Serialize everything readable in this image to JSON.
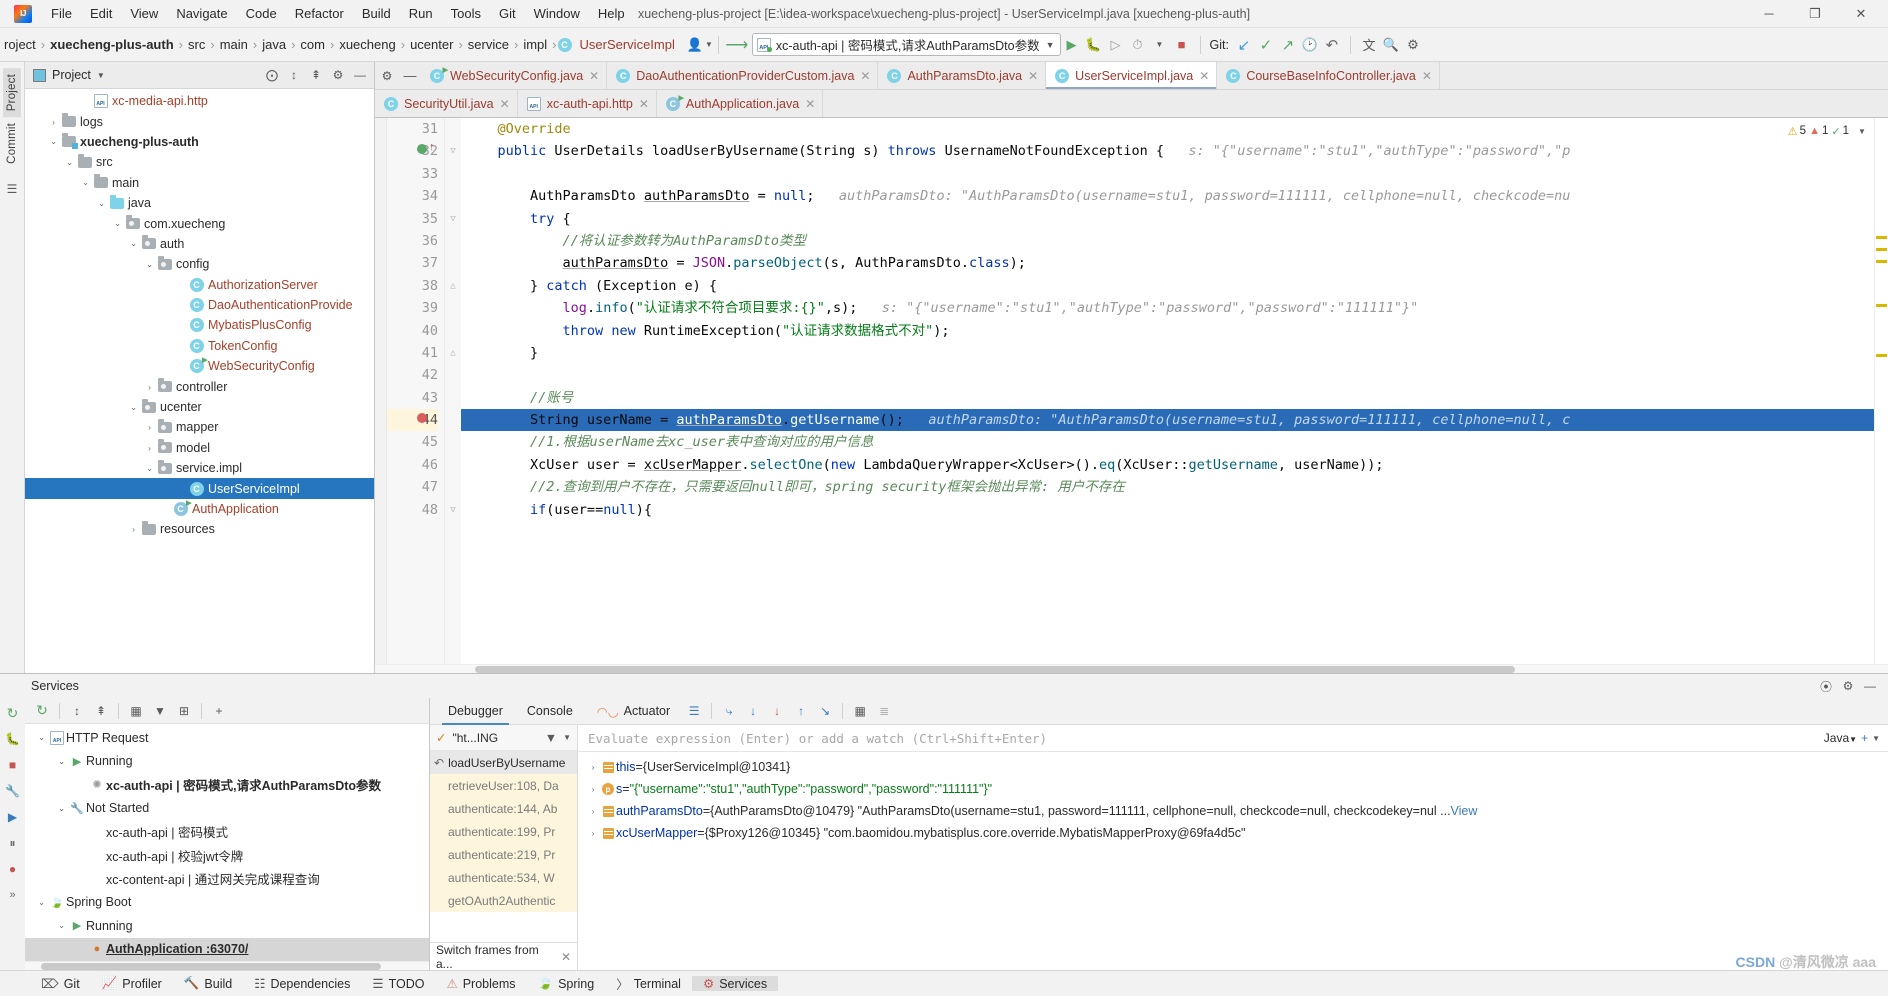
{
  "titlebar": {
    "window_title": "xuecheng-plus-project [E:\\idea-workspace\\xuecheng-plus-project] - UserServiceImpl.java [xuecheng-plus-auth]",
    "menus": [
      "File",
      "Edit",
      "View",
      "Navigate",
      "Code",
      "Refactor",
      "Build",
      "Run",
      "Tools",
      "Git",
      "Window",
      "Help"
    ],
    "controls": {
      "minimize": "─",
      "maximize": "❐",
      "close": "✕"
    }
  },
  "navbar": {
    "crumbs": [
      "roject",
      "xuecheng-plus-auth",
      "src",
      "main",
      "java",
      "com",
      "xuecheng",
      "ucenter",
      "service",
      "impl",
      "UserServiceImpl"
    ],
    "crumb_sep": "›",
    "class_icon_letter": "C",
    "run_config": "xc-auth-api | 密码模式,请求AuthParamsDto参数",
    "api_badge": "API",
    "git_label": "Git:",
    "icons": [
      "profile-icon",
      "hammer-icon",
      "run-icon",
      "debug-icon",
      "coverage-icon",
      "profiler-icon",
      "stop-icon",
      "update-project-icon",
      "commit-icon",
      "push-icon",
      "history-icon",
      "rollback-icon",
      "translate-icon",
      "search-everywhere-icon",
      "settings-icon"
    ]
  },
  "left_strip": {
    "tabs": [
      "Project",
      "Commit"
    ],
    "icons": [
      "structure-icon"
    ]
  },
  "project_panel": {
    "title": "Project",
    "actions": [
      "locate-icon",
      "expand-all-icon",
      "collapse-all-icon",
      "settings-icon",
      "hide-icon"
    ],
    "tree": [
      {
        "indent": 3,
        "twist": "",
        "icon": "api-file",
        "label": "xc-media-api.http",
        "style": "red"
      },
      {
        "indent": 1,
        "twist": "›",
        "icon": "folder",
        "label": "logs",
        "style": ""
      },
      {
        "indent": 1,
        "twist": "⌄",
        "icon": "folder-module",
        "label": "xuecheng-plus-auth",
        "style": "bold"
      },
      {
        "indent": 2,
        "twist": "⌄",
        "icon": "folder",
        "label": "src",
        "style": ""
      },
      {
        "indent": 3,
        "twist": "⌄",
        "icon": "folder",
        "label": "main",
        "style": ""
      },
      {
        "indent": 4,
        "twist": "⌄",
        "icon": "folder-blue",
        "label": "java",
        "style": ""
      },
      {
        "indent": 5,
        "twist": "⌄",
        "icon": "folder-pkg",
        "label": "com.xuecheng",
        "style": ""
      },
      {
        "indent": 6,
        "twist": "⌄",
        "icon": "folder-pkg",
        "label": "auth",
        "style": ""
      },
      {
        "indent": 7,
        "twist": "⌄",
        "icon": "folder-pkg",
        "label": "config",
        "style": ""
      },
      {
        "indent": 9,
        "twist": "",
        "icon": "class",
        "label": "AuthorizationServer",
        "style": "red"
      },
      {
        "indent": 9,
        "twist": "",
        "icon": "class",
        "label": "DaoAuthenticationProvide",
        "style": "red"
      },
      {
        "indent": 9,
        "twist": "",
        "icon": "class",
        "label": "MybatisPlusConfig",
        "style": "red"
      },
      {
        "indent": 9,
        "twist": "",
        "icon": "class",
        "label": "TokenConfig",
        "style": "red"
      },
      {
        "indent": 9,
        "twist": "",
        "icon": "class-run",
        "label": "WebSecurityConfig",
        "style": "red"
      },
      {
        "indent": 7,
        "twist": "›",
        "icon": "folder-pkg",
        "label": "controller",
        "style": ""
      },
      {
        "indent": 6,
        "twist": "⌄",
        "icon": "folder-pkg",
        "label": "ucenter",
        "style": ""
      },
      {
        "indent": 7,
        "twist": "›",
        "icon": "folder-pkg",
        "label": "mapper",
        "style": ""
      },
      {
        "indent": 7,
        "twist": "›",
        "icon": "folder-pkg",
        "label": "model",
        "style": ""
      },
      {
        "indent": 7,
        "twist": "⌄",
        "icon": "folder-pkg",
        "label": "service.impl",
        "style": ""
      },
      {
        "indent": 9,
        "twist": "",
        "icon": "class",
        "label": "UserServiceImpl",
        "style": "selected"
      },
      {
        "indent": 8,
        "twist": "",
        "icon": "class-spring",
        "label": "AuthApplication",
        "style": "red"
      },
      {
        "indent": 6,
        "twist": "›",
        "icon": "folder",
        "label": "resources",
        "style": ""
      }
    ]
  },
  "editor": {
    "tabs_row1": [
      {
        "label": "WebSecurityConfig.java",
        "icon": "class-run",
        "active": false
      },
      {
        "label": "DaoAuthenticationProviderCustom.java",
        "icon": "class",
        "active": false
      },
      {
        "label": "AuthParamsDto.java",
        "icon": "class",
        "active": false
      },
      {
        "label": "UserServiceImpl.java",
        "icon": "class",
        "active": true
      },
      {
        "label": "CourseBaseInfoController.java",
        "icon": "class",
        "active": false
      }
    ],
    "tabs_row2": [
      {
        "label": "SecurityUtil.java",
        "icon": "class",
        "active": false
      },
      {
        "label": "xc-auth-api.http",
        "icon": "api-file",
        "active": false
      },
      {
        "label": "AuthApplication.java",
        "icon": "class-spring",
        "active": false
      }
    ],
    "gear_icon": "gear-icon",
    "minimize_icon": "minimize-icon",
    "inspections": {
      "warnings": "5",
      "errors": "1",
      "typos": "1"
    },
    "lines": [
      {
        "num": "31",
        "indent": 0,
        "text": "@Override"
      },
      {
        "num": "32",
        "indent": 0,
        "text": "public UserDetails loadUserByUsername(String s) throws UsernameNotFoundException {",
        "hint": "s: \"{\"username\":\"stu1\",\"authType\":\"password\",\"p"
      },
      {
        "num": "33",
        "indent": 0,
        "text": ""
      },
      {
        "num": "34",
        "indent": 0,
        "text": "AuthParamsDto authParamsDto = null;",
        "hint": "authParamsDto: \"AuthParamsDto(username=stu1, password=111111, cellphone=null, checkcode=nu"
      },
      {
        "num": "35",
        "indent": 0,
        "text": "try {"
      },
      {
        "num": "36",
        "indent": 0,
        "text": "//将认证参数转为AuthParamsDto类型"
      },
      {
        "num": "37",
        "indent": 0,
        "text": "authParamsDto = JSON.parseObject(s, AuthParamsDto.class);"
      },
      {
        "num": "38",
        "indent": 0,
        "text": "} catch (Exception e) {"
      },
      {
        "num": "39",
        "indent": 0,
        "text": "log.info(\"认证请求不符合项目要求:{}\",s);",
        "hint": "s: \"{\"username\":\"stu1\",\"authType\":\"password\",\"password\":\"111111\"}\""
      },
      {
        "num": "40",
        "indent": 0,
        "text": "throw new RuntimeException(\"认证请求数据格式不对\");"
      },
      {
        "num": "41",
        "indent": 0,
        "text": "}"
      },
      {
        "num": "42",
        "indent": 0,
        "text": ""
      },
      {
        "num": "43",
        "indent": 0,
        "text": "//账号"
      },
      {
        "num": "44",
        "indent": 0,
        "text": "String userName = authParamsDto.getUsername();",
        "hint": "authParamsDto: \"AuthParamsDto(username=stu1, password=111111, cellphone=null, c",
        "highlight": true
      },
      {
        "num": "45",
        "indent": 0,
        "text": "//1.根据userName去xc_user表中查询对应的用户信息"
      },
      {
        "num": "46",
        "indent": 0,
        "text": "XcUser user = xcUserMapper.selectOne(new LambdaQueryWrapper<XcUser>().eq(XcUser::getUsername, userName));"
      },
      {
        "num": "47",
        "indent": 0,
        "text": "//2.查询到用户不存在，只需要返回null即可，spring security框架会抛出异常: 用户不存在"
      },
      {
        "num": "48",
        "indent": 0,
        "text": "if(user==null){"
      }
    ]
  },
  "bottom": {
    "panel_title": "Services",
    "panel_actions": [
      "settings-icon",
      "help-icon",
      "hide-icon"
    ],
    "side_icons": [
      "rerun-icon",
      "debug-icon",
      "stop-icon",
      "settings-wrench-icon",
      "run-icon",
      "pause-icon",
      "mute-icon",
      "expand-icon"
    ],
    "services": {
      "toolbar_icons": [
        "rerun-icon",
        "expand-all-icon",
        "collapse-all-icon",
        "group-icon",
        "filter-icon",
        "add-tab-icon",
        "add-icon"
      ],
      "tree": [
        {
          "indent": 0,
          "twist": "⌄",
          "icon": "api",
          "label": "HTTP Request",
          "style": ""
        },
        {
          "indent": 1,
          "twist": "⌄",
          "icon": "run-green",
          "label": "Running",
          "style": ""
        },
        {
          "indent": 2,
          "twist": "",
          "icon": "spinner",
          "label": "xc-auth-api | 密码模式,请求AuthParamsDto参数",
          "style": "bold"
        },
        {
          "indent": 1,
          "twist": "⌄",
          "icon": "wrench",
          "label": "Not Started",
          "style": ""
        },
        {
          "indent": 2,
          "twist": "",
          "icon": "",
          "label": "xc-auth-api | 密码模式",
          "style": ""
        },
        {
          "indent": 2,
          "twist": "",
          "icon": "",
          "label": "xc-auth-api | 校验jwt令牌",
          "style": ""
        },
        {
          "indent": 2,
          "twist": "",
          "icon": "",
          "label": "xc-content-api | 通过网关完成课程查询",
          "style": ""
        },
        {
          "indent": 0,
          "twist": "⌄",
          "icon": "spring",
          "label": "Spring Boot",
          "style": ""
        },
        {
          "indent": 1,
          "twist": "⌄",
          "icon": "run-green",
          "label": "Running",
          "style": ""
        },
        {
          "indent": 2,
          "twist": "",
          "icon": "spring-run",
          "label": "AuthApplication :63070/",
          "style": "bold sel"
        }
      ]
    },
    "debugger": {
      "tabs": [
        "Debugger",
        "Console",
        "Actuator"
      ],
      "active_tab": "Debugger",
      "toolbar_icons": [
        "layout-icon",
        "step-over-icon",
        "step-into-icon",
        "force-step-into-icon",
        "step-out-icon",
        "run-to-cursor-icon",
        "evaluate-icon",
        "settings-icon"
      ],
      "frames_selector": "\"ht...ING",
      "frames_filter_icon": "filter-icon",
      "frames": [
        {
          "label": "loadUserByUsername",
          "style": "cur"
        },
        {
          "label": "retrieveUser:108, Da",
          "style": "yel"
        },
        {
          "label": "authenticate:144, Ab",
          "style": "yel"
        },
        {
          "label": "authenticate:199, Pr",
          "style": "yel"
        },
        {
          "label": "authenticate:219, Pr",
          "style": "yel"
        },
        {
          "label": "authenticate:534, W",
          "style": "yel"
        },
        {
          "label": "getOAuth2Authentic",
          "style": "yel"
        }
      ],
      "frames_footer": "Switch frames from a...",
      "evaluate_placeholder": "Evaluate expression (Enter) or add a watch (Ctrl+Shift+Enter)",
      "language_selector": "Java",
      "variables": [
        {
          "twist": "›",
          "icon": "object",
          "name": "this",
          "eq": " = ",
          "value": "{UserServiceImpl@10341}",
          "value_style": "plain"
        },
        {
          "twist": "›",
          "icon": "param",
          "name": "s",
          "eq": " = ",
          "value": "\"{\"username\":\"stu1\",\"authType\":\"password\",\"password\":\"111111\"}\"",
          "value_style": "string"
        },
        {
          "twist": "›",
          "icon": "object",
          "name": "authParamsDto",
          "eq": " = ",
          "value": "{AuthParamsDto@10479} \"AuthParamsDto(username=stu1, password=111111, cellphone=null, checkcode=null, checkcodekey=nul ...",
          "value_style": "mixed",
          "more": "View"
        },
        {
          "twist": "›",
          "icon": "object",
          "name": "xcUserMapper",
          "eq": " = ",
          "value": "{$Proxy126@10345} \"com.baomidou.mybatisplus.core.override.MybatisMapperProxy@69fa4d5c\"",
          "value_style": "mixed"
        }
      ]
    }
  },
  "statusbar": {
    "items": [
      {
        "icon": "git-icon",
        "label": "Git"
      },
      {
        "icon": "profiler-icon",
        "label": "Profiler"
      },
      {
        "icon": "build-icon",
        "label": "Build"
      },
      {
        "icon": "dependencies-icon",
        "label": "Dependencies"
      },
      {
        "icon": "todo-icon",
        "label": "TODO"
      },
      {
        "icon": "problems-icon",
        "label": "Problems"
      },
      {
        "icon": "spring-icon",
        "label": "Spring"
      },
      {
        "icon": "terminal-icon",
        "label": "Terminal"
      },
      {
        "icon": "services-icon",
        "label": "Services",
        "active": true
      }
    ]
  },
  "watermark": {
    "prefix": "CSDN",
    "text": "@清风微凉 aaa"
  },
  "colors": {
    "accent_blue": "#2675bf",
    "selection_blue": "#2a6bb8",
    "keyword": "#0033b3",
    "string": "#067d17",
    "comment": "#8c8c8c",
    "field": "#871094",
    "tab_red": "#9c3b2e",
    "green_run": "#59a869"
  }
}
